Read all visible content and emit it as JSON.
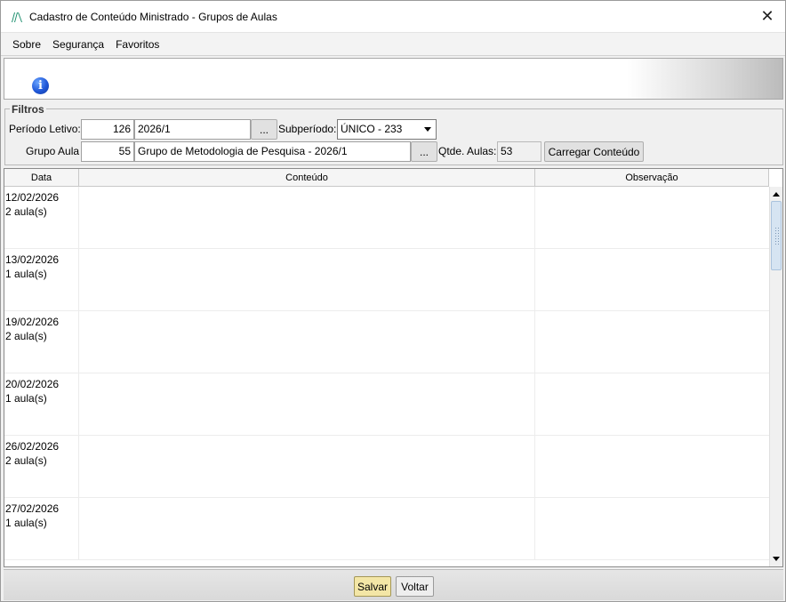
{
  "window": {
    "title": "Cadastro de Conteúdo Ministrado - Grupos de Aulas",
    "close_glyph": "✕"
  },
  "menu": {
    "items": [
      {
        "label": "Sobre"
      },
      {
        "label": "Segurança"
      },
      {
        "label": "Favoritos"
      }
    ]
  },
  "banner": {
    "info_glyph": "i"
  },
  "filters": {
    "legend": "Filtros",
    "periodo_label": "Período Letivo:",
    "periodo_code": "126",
    "periodo_value": "2026/1",
    "browse_label": "...",
    "subperiodo_label": "Subperíodo:",
    "subperiodo_value": "ÚNICO - 233",
    "grupo_label": "Grupo Aula",
    "grupo_code": "55",
    "grupo_value": "Grupo de Metodologia de Pesquisa - 2026/1",
    "qtde_label": "Qtde. Aulas:",
    "qtde_value": "53",
    "carregar_label": "Carregar Conteúdo"
  },
  "grid": {
    "columns": [
      "Data",
      "Conteúdo",
      "Observação"
    ],
    "rows": [
      {
        "date": "12/02/2026",
        "aulas": "2 aula(s)",
        "conteudo": "",
        "observacao": ""
      },
      {
        "date": "13/02/2026",
        "aulas": "1 aula(s)",
        "conteudo": "",
        "observacao": ""
      },
      {
        "date": "19/02/2026",
        "aulas": "2 aula(s)",
        "conteudo": "",
        "observacao": ""
      },
      {
        "date": "20/02/2026",
        "aulas": "1 aula(s)",
        "conteudo": "",
        "observacao": ""
      },
      {
        "date": "26/02/2026",
        "aulas": "2 aula(s)",
        "conteudo": "",
        "observacao": ""
      },
      {
        "date": "27/02/2026",
        "aulas": "1 aula(s)",
        "conteudo": "",
        "observacao": ""
      }
    ]
  },
  "footer": {
    "save_label": "Salvar",
    "back_label": "Voltar"
  }
}
